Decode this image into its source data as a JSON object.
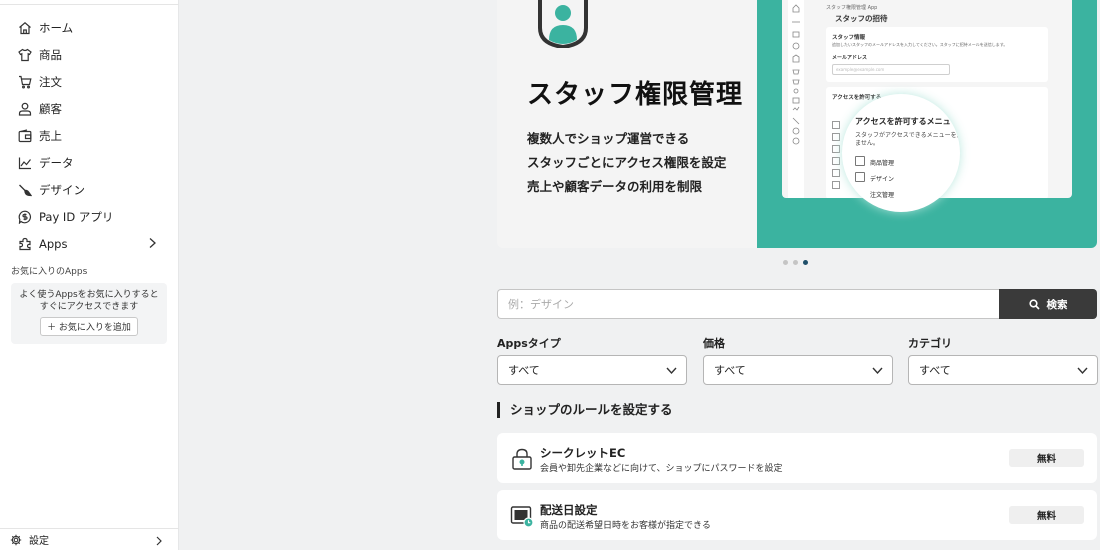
{
  "sidebar": {
    "items": [
      {
        "label": "ホーム",
        "icon": "home-icon"
      },
      {
        "label": "商品",
        "icon": "shirt-icon"
      },
      {
        "label": "注文",
        "icon": "cart-icon"
      },
      {
        "label": "顧客",
        "icon": "person-icon"
      },
      {
        "label": "売上",
        "icon": "wallet-icon"
      },
      {
        "label": "データ",
        "icon": "chart-line-icon"
      },
      {
        "label": "デザイン",
        "icon": "brush-icon"
      },
      {
        "label": "Pay ID アプリ",
        "icon": "payid-icon"
      },
      {
        "label": "Apps",
        "icon": "puzzle-icon"
      }
    ],
    "favorites": {
      "title": "お気に入りのApps",
      "empty_line1": "よく使うAppsをお気に入りすると",
      "empty_line2": "すぐにアクセスできます",
      "add_label": "＋ お気に入りを追加"
    },
    "settings_label": "設定"
  },
  "banner": {
    "title": "スタッフ権限管理",
    "lines": [
      "複数人でショップ運営できる",
      "スタッフごとにアクセス権限を設定",
      "売上や顧客データの利用を制限"
    ],
    "accent_color": "#3bb3a0",
    "mock": {
      "app_name": "スタッフ権限管理 App",
      "page_title": "スタッフの招待",
      "card1_title": "スタッフ情報",
      "card1_desc": "追加したいスタッフのメールアドレスを入力してください。スタッフに招待メールを送信します。",
      "email_label": "メールアドレス",
      "email_placeholder": "example@example.com",
      "card2_title": "アクセスを許可する",
      "zoom_title": "アクセスを許可するメニュー",
      "zoom_desc1": "スタッフがアクセスできるメニューを選",
      "zoom_desc2": "ません。",
      "zoom_items": [
        "商品管理",
        "デザイン",
        "注文管理"
      ]
    },
    "dots_total": 3,
    "dots_active": 3
  },
  "search": {
    "placeholder": "例：デザイン",
    "button_label": "検索"
  },
  "filters": [
    {
      "label": "Appsタイプ",
      "value": "すべて"
    },
    {
      "label": "価格",
      "value": "すべて"
    },
    {
      "label": "カテゴリ",
      "value": "すべて"
    }
  ],
  "section_title": "ショップのルールを設定する",
  "apps": [
    {
      "name": "シークレットEC",
      "desc": "会員や卸先企業などに向けて、ショップにパスワードを設定",
      "badge": "無料",
      "icon": "lock-icon"
    },
    {
      "name": "配送日設定",
      "desc": "商品の配送希望日時をお客様が指定できる",
      "badge": "無料",
      "icon": "calendar-clock-icon"
    }
  ]
}
